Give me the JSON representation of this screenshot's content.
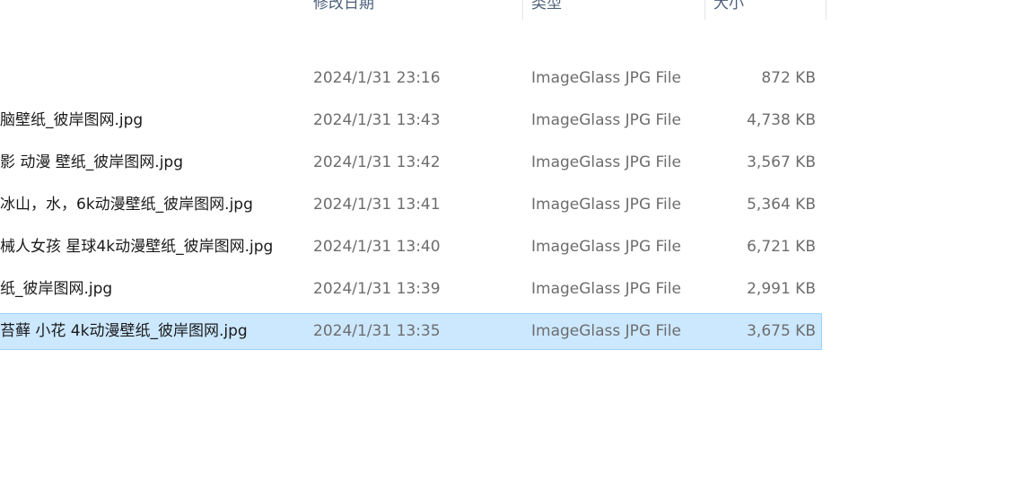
{
  "columns": {
    "date": "修改日期",
    "type": "类型",
    "size": "大小"
  },
  "rows": [
    {
      "name": "",
      "date": "2024/1/31 23:16",
      "type": "ImageGlass JPG File",
      "size": "872 KB"
    },
    {
      "name": "脑壁纸_彼岸图网.jpg",
      "date": "2024/1/31 13:43",
      "type": "ImageGlass JPG File",
      "size": "4,738 KB"
    },
    {
      "name": "影 动漫 壁纸_彼岸图网.jpg",
      "date": "2024/1/31 13:42",
      "type": "ImageGlass JPG File",
      "size": "3,567 KB"
    },
    {
      "name": "冰山，水，6k动漫壁纸_彼岸图网.jpg",
      "date": "2024/1/31 13:41",
      "type": "ImageGlass JPG File",
      "size": "5,364 KB"
    },
    {
      "name": "械人女孩 星球4k动漫壁纸_彼岸图网.jpg",
      "date": "2024/1/31 13:40",
      "type": "ImageGlass JPG File",
      "size": "6,721 KB"
    },
    {
      "name": "纸_彼岸图网.jpg",
      "date": "2024/1/31 13:39",
      "type": "ImageGlass JPG File",
      "size": "2,991 KB"
    },
    {
      "name": "苔藓 小花 4k动漫壁纸_彼岸图网.jpg",
      "date": "2024/1/31 13:35",
      "type": "ImageGlass JPG File",
      "size": "3,675 KB"
    }
  ]
}
